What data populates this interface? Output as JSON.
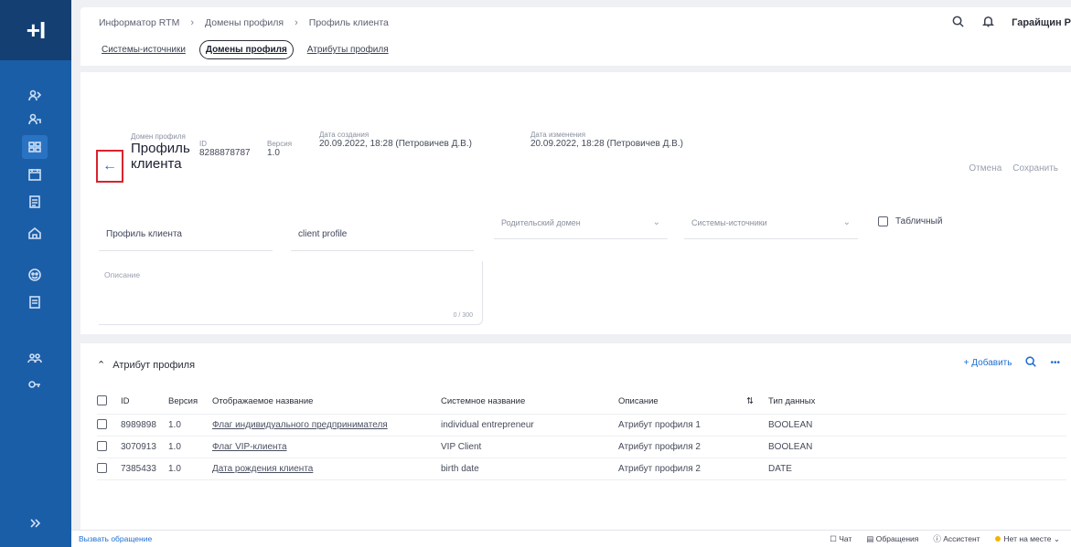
{
  "app": {
    "logo": "+I"
  },
  "breadcrumb": [
    "Информатор RTM",
    "Домены профиля",
    "Профиль клиента"
  ],
  "user": {
    "name": "Гарайщин Р"
  },
  "tabs": [
    {
      "label": "Системы-источники",
      "active": false
    },
    {
      "label": "Домены профиля",
      "active": true
    },
    {
      "label": "Атрибуты профиля",
      "active": false
    }
  ],
  "header": {
    "domain_label": "Домен профиля",
    "title": "Профиль клиента",
    "id_label": "ID",
    "id_value": "8288878787",
    "version_label": "Версия",
    "version_value": "1.0",
    "created_label": "Дата создания",
    "created_value": "20.09.2022, 18:28 (Петровичев Д.В.)",
    "modified_label": "Дата изменения",
    "modified_value": "20.09.2022, 18:28 (Петровичев Д.В.)",
    "cancel_label": "Отмена",
    "save_label": "Сохранить"
  },
  "form": {
    "name_value": "Профиль клиента",
    "system_name_value": "client profile",
    "parent_domain_placeholder": "Родительский домен",
    "system_source_placeholder": "Системы-источники",
    "tabular_label": "Табличный",
    "description_label": "Описание",
    "description_counter": "0 / 300"
  },
  "attributes": {
    "section_title": "Атрибут профиля",
    "add_label": "Добавить",
    "columns": [
      "ID",
      "Версия",
      "Отображаемое название",
      "Системное название",
      "Описание",
      "Тип данных"
    ],
    "rows": [
      {
        "id": "8989898",
        "version": "1.0",
        "display_name": "Флаг индивидуального предпринимателя",
        "system_name": "individual entrepreneur",
        "description": "Атрибут профиля 1",
        "type": "BOOLEAN"
      },
      {
        "id": "3070913",
        "version": "1.0",
        "display_name": "Флаг VIP-клиента",
        "system_name": "VIP Client",
        "description": "Атрибут профиля 2",
        "type": "BOOLEAN"
      },
      {
        "id": "7385433",
        "version": "1.0",
        "display_name": "Дата рождения клиента",
        "system_name": "birth date",
        "description": "Атрибут профиля 2",
        "type": "DATE"
      }
    ]
  },
  "footer": {
    "left": "Вызвать обращение",
    "chat": "Чат",
    "requests": "Обращения",
    "assistant": "Ассистент",
    "status": "Нет на месте"
  },
  "colors": {
    "sidebar": "#1b5ea8",
    "accent": "#1f6fd1",
    "highlight": "#d9232d"
  }
}
